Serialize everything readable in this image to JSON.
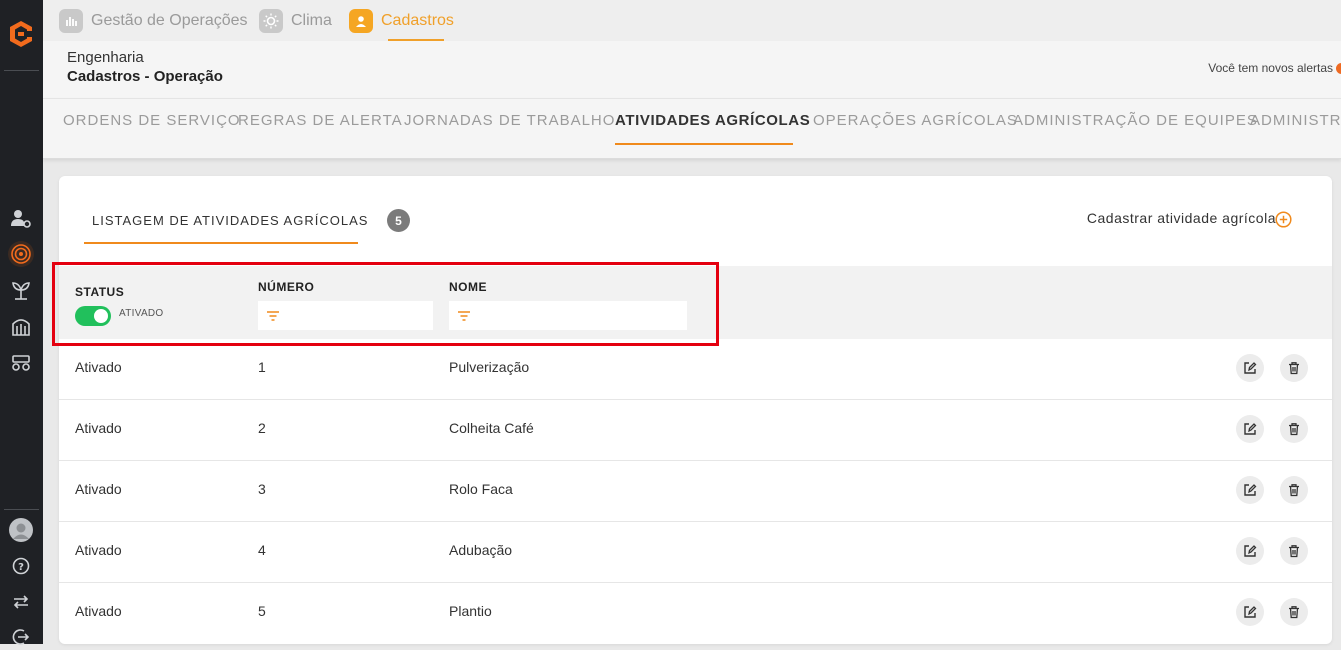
{
  "topnav": {
    "tabs": [
      {
        "label": "Gestão de Operações",
        "icon": "operations-icon",
        "active": false
      },
      {
        "label": "Clima",
        "icon": "sun-icon",
        "active": false
      },
      {
        "label": "Cadastros",
        "icon": "user-icon",
        "active": true
      }
    ]
  },
  "header": {
    "line1": "Engenharia",
    "line2": "Cadastros - Operação",
    "alerts": "Você tem novos alertas"
  },
  "subnav": {
    "items": [
      "ORDENS DE SERVIÇO",
      "REGRAS DE ALERTA",
      "JORNADAS DE TRABALHO",
      "ATIVIDADES AGRÍCOLAS",
      "OPERAÇÕES AGRÍCOLAS",
      "ADMINISTRAÇÃO DE EQUIPES",
      "ADMINISTR"
    ],
    "active_index": 3
  },
  "card": {
    "list_tab": "LISTAGEM DE ATIVIDADES AGRÍCOLAS",
    "count": "5",
    "add_label": "Cadastrar atividade agrícola"
  },
  "filters": {
    "status_label": "STATUS",
    "toggle_label": "ATIVADO",
    "toggle_on": true,
    "numero_label": "NÚMERO",
    "nome_label": "NOME"
  },
  "rows": [
    {
      "status": "Ativado",
      "numero": "1",
      "nome": "Pulverização"
    },
    {
      "status": "Ativado",
      "numero": "2",
      "nome": "Colheita Café"
    },
    {
      "status": "Ativado",
      "numero": "3",
      "nome": "Rolo Faca"
    },
    {
      "status": "Ativado",
      "numero": "4",
      "nome": "Adubação"
    },
    {
      "status": "Ativado",
      "numero": "5",
      "nome": "Plantio"
    }
  ],
  "colors": {
    "accent": "#f08a1c",
    "sidebar": "#1f2125",
    "toggle_on": "#21c05c",
    "highlight": "#e4000f"
  }
}
